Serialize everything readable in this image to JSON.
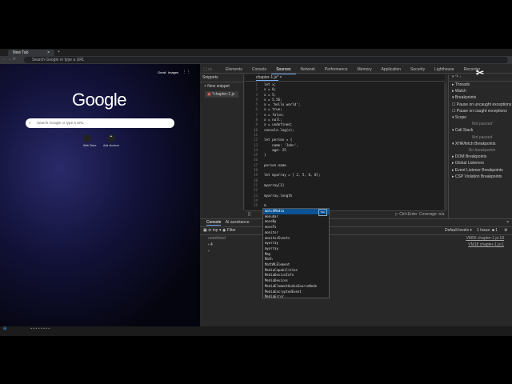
{
  "browser": {
    "tab_title": "New Tab",
    "omnibox_placeholder": "Search Google or type a URL"
  },
  "newtab": {
    "links": [
      "Gmail",
      "Images"
    ],
    "logo": "Google",
    "search_placeholder": "Search Google or type a URL",
    "shortcuts": [
      "Web Store",
      "Add shortcut"
    ]
  },
  "devtools": {
    "tabs": [
      "Elements",
      "Console",
      "Sources",
      "Network",
      "Performance",
      "Memory",
      "Application",
      "Security",
      "Lighthouse",
      "Recorder"
    ],
    "navigator": {
      "tab": "Snippets",
      "new_snippet": "+ New snippet",
      "file": "*chapter-1.js"
    },
    "editor_tab": "chapter-1.js*",
    "code": [
      "let x;",
      "x = 0;",
      "x = 5;",
      "x = 5.56;",
      "x = 'hello world';",
      "x = true;",
      "x = false;",
      "x = null;",
      "x = undefined;",
      "console.log(x);",
      "",
      "let person = {",
      "    name: 'John',",
      "    age: 25",
      "}",
      "",
      "person.name",
      "",
      "let myarray = [ 2, 5, 6, 8];",
      "",
      "myarray[3]",
      "",
      "myarray.length",
      "",
      "m"
    ],
    "status": {
      "run": "▷ Ctrl+Enter",
      "coverage": "Coverage: n/a"
    },
    "right_pane": [
      {
        "label": "▸ Threads"
      },
      {
        "label": "▸ Watch"
      },
      {
        "label": "▾ Breakpoints"
      },
      {
        "check": "Pause on uncaught exceptions"
      },
      {
        "check": "Pause on caught exceptions"
      },
      {
        "label": "▾ Scope"
      },
      {
        "note": "Not paused"
      },
      {
        "label": "▾ Call Stack"
      },
      {
        "note": "Not paused"
      },
      {
        "label": "▾ XHR/fetch Breakpoints"
      },
      {
        "note": "No breakpoints"
      },
      {
        "label": "▸ DOM Breakpoints"
      },
      {
        "label": "▸ Global Listeners"
      },
      {
        "label": "▸ Event Listener Breakpoints"
      },
      {
        "label": "▸ CSP Violation Breakpoints"
      }
    ],
    "autocomplete": {
      "hint": "Tab",
      "items": [
        "matchMedia",
        "menubar",
        "moveBy",
        "moveTo",
        "monitor",
        "monitorEvents",
        "myarray",
        "myarray",
        "Map",
        "Math",
        "MathMLElement",
        "MediaCapabilities",
        "MediaDeviceInfo",
        "MediaDevices",
        "MediaElementAudioSourceNode",
        "MediaEncryptedEvent",
        "MediaError"
      ]
    },
    "drawer": {
      "tabs": [
        "Console",
        "AI assistance"
      ],
      "context": "top ▾",
      "filter": "Filter",
      "levels": "Default levels ▾",
      "issues": "1 Issue: ■ 1",
      "messages": [
        {
          "text": "undefined",
          "source": "VM55 chapter-1.js:18"
        },
        {
          "text": "‹ 4",
          "source": "VM18 chapter-1.js:1"
        },
        {
          "text": "›",
          "source": ""
        }
      ]
    }
  }
}
